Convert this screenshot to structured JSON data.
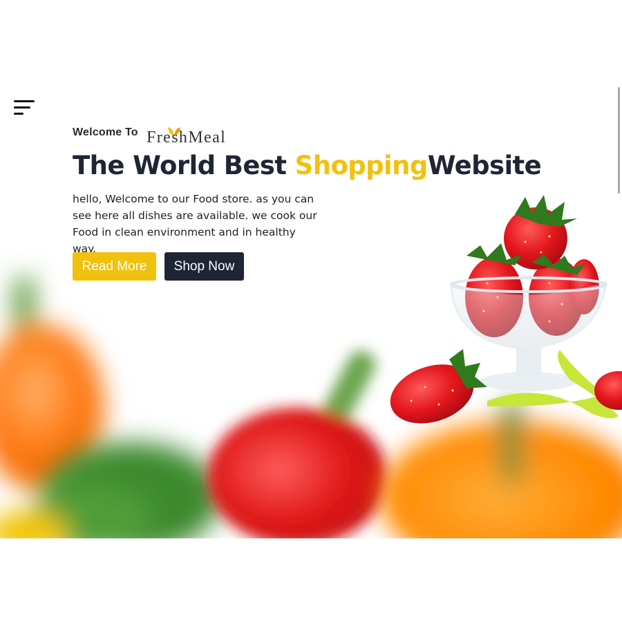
{
  "nav": {
    "menu_icon": "menu-icon"
  },
  "hero": {
    "welcome_prefix": "Welcome To",
    "brand": "FreshMeal",
    "headline": {
      "part1": "The World Best ",
      "accent": "Shopping",
      "part2": "Website"
    },
    "intro": "hello, Welcome to our Food store. as you can see here all dishes are available. we cook our Food in clean environment and in healthy way.",
    "buttons": {
      "read_more": "Read More",
      "shop_now": "Shop Now"
    }
  },
  "colors": {
    "accent": "#f0c10d",
    "dark": "#1f2535",
    "text": "#1f1f1f"
  },
  "icons": [
    "menu-icon",
    "leaf-icon"
  ],
  "images": [
    "blurred-vegetables-background",
    "strawberry-bowl-image"
  ]
}
